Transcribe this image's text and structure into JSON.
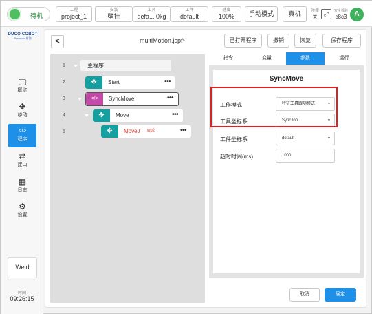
{
  "header": {
    "status": "待机",
    "project": {
      "label": "工程",
      "value": "project_1"
    },
    "install": {
      "label": "安装",
      "value": "壁挂"
    },
    "tool": {
      "label": "工具",
      "value": "defa... 0kg"
    },
    "workpiece": {
      "label": "工件",
      "value": "default"
    },
    "speed": {
      "label": "速度",
      "value": "100%"
    },
    "mode_button": "手动模式",
    "robot_button": "真机",
    "collab": {
      "label": "碰撞",
      "value": "关"
    },
    "safety": {
      "label": "安全校验",
      "value": "c8c3"
    },
    "avatar": "A"
  },
  "sidebar": {
    "logo_line1": "DUCO COBOT",
    "logo_line2": "Premium 系列",
    "items": [
      {
        "label": "概览",
        "icon": "monitor-icon"
      },
      {
        "label": "移动",
        "icon": "move-icon"
      },
      {
        "label": "程序",
        "icon": "code-icon"
      },
      {
        "label": "接口",
        "icon": "swap-icon"
      },
      {
        "label": "日志",
        "icon": "calendar-icon"
      },
      {
        "label": "设置",
        "icon": "gear-icon"
      }
    ],
    "weld_button": "Weld",
    "time_label": "时间",
    "time_value": "09:26:15"
  },
  "editor": {
    "file_title": "multiMotion.jspf*",
    "buttons": [
      "已打开程序",
      "撤销",
      "恢复",
      "保存程序"
    ]
  },
  "tree": {
    "lines": [
      {
        "no": "1",
        "label": "主程序"
      },
      {
        "no": "2",
        "label": "Start"
      },
      {
        "no": "3",
        "label": "SyncMove"
      },
      {
        "no": "4",
        "label": "Move"
      },
      {
        "no": "5",
        "label": "MoveJ",
        "sub": "wp2"
      }
    ],
    "more_glyph": "•••"
  },
  "tabs": [
    "指令",
    "变量",
    "参数",
    "运行"
  ],
  "params": {
    "title": "SyncMove",
    "fields": [
      {
        "label": "工作模式",
        "value": "特征工具跟随模式"
      },
      {
        "label": "工具坐标系",
        "value": "SyncTool"
      },
      {
        "label": "工件坐标系",
        "value": "default"
      },
      {
        "label": "超时时间(ms)",
        "value": "1000"
      }
    ]
  },
  "footer": {
    "cancel": "取消",
    "confirm": "确定"
  },
  "colors": {
    "accent": "#1e90e8",
    "teal": "#14a0a0",
    "magenta": "#c34aa8",
    "highlight": "#e02020",
    "status": "#4fbf5f"
  }
}
